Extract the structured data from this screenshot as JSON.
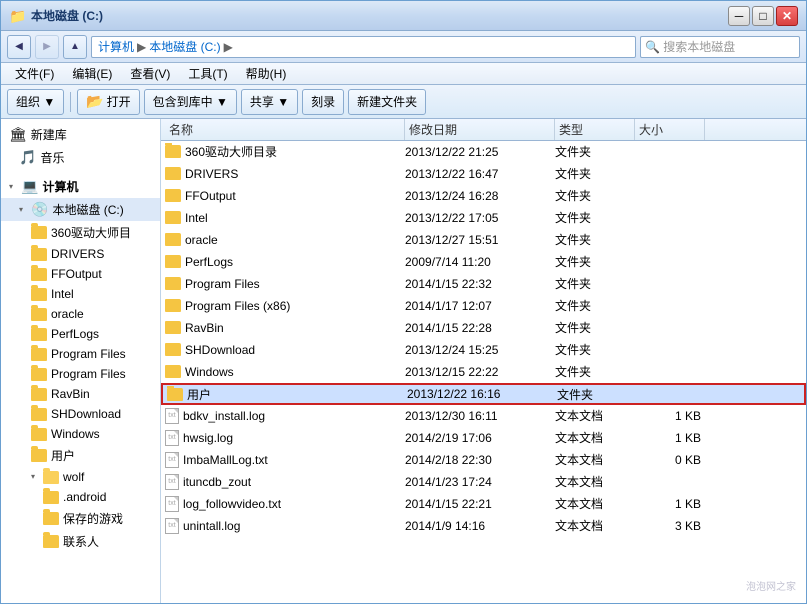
{
  "window": {
    "title": "本地磁盘 (C:)",
    "controls": {
      "minimize": "─",
      "maximize": "□",
      "close": "✕"
    }
  },
  "breadcrumb": {
    "parts": [
      "计算机",
      "本地磁盘 (C:)"
    ]
  },
  "menu": {
    "items": [
      "文件(F)",
      "编辑(E)",
      "查看(V)",
      "工具(T)",
      "帮助(H)"
    ]
  },
  "toolbar": {
    "organize": "组织 ▼",
    "open": "打开",
    "include_library": "包含到库中 ▼",
    "share": "共享 ▼",
    "burn": "刻录",
    "new_folder": "新建文件夹"
  },
  "columns": {
    "name": "名称",
    "date": "修改日期",
    "type": "类型",
    "size": "大小"
  },
  "sidebar": {
    "items": [
      {
        "label": "新建库",
        "indent": 0,
        "icon": "library",
        "type": "library"
      },
      {
        "label": "音乐",
        "indent": 1,
        "icon": "music",
        "type": "music"
      },
      {
        "label": "计算机",
        "indent": 0,
        "icon": "computer",
        "type": "computer",
        "expanded": true
      },
      {
        "label": "本地磁盘 (C:)",
        "indent": 1,
        "icon": "drive",
        "type": "drive",
        "selected": true
      },
      {
        "label": "360驱动大师目",
        "indent": 2,
        "icon": "folder",
        "type": "folder"
      },
      {
        "label": "DRIVERS",
        "indent": 2,
        "icon": "folder",
        "type": "folder"
      },
      {
        "label": "FFOutput",
        "indent": 2,
        "icon": "folder",
        "type": "folder"
      },
      {
        "label": "Intel",
        "indent": 2,
        "icon": "folder",
        "type": "folder"
      },
      {
        "label": "oracle",
        "indent": 2,
        "icon": "folder",
        "type": "folder"
      },
      {
        "label": "PerfLogs",
        "indent": 2,
        "icon": "folder",
        "type": "folder"
      },
      {
        "label": "Program Files",
        "indent": 2,
        "icon": "folder",
        "type": "folder"
      },
      {
        "label": "Program Files",
        "indent": 2,
        "icon": "folder",
        "type": "folder"
      },
      {
        "label": "RavBin",
        "indent": 2,
        "icon": "folder",
        "type": "folder"
      },
      {
        "label": "SHDownload",
        "indent": 2,
        "icon": "folder",
        "type": "folder"
      },
      {
        "label": "Windows",
        "indent": 2,
        "icon": "folder",
        "type": "folder"
      },
      {
        "label": "用户",
        "indent": 2,
        "icon": "folder",
        "type": "folder"
      },
      {
        "label": "wolf",
        "indent": 2,
        "icon": "folder",
        "type": "folder",
        "expanded": true
      },
      {
        "label": ".android",
        "indent": 3,
        "icon": "folder",
        "type": "folder"
      },
      {
        "label": "保存的游戏",
        "indent": 3,
        "icon": "folder",
        "type": "folder"
      },
      {
        "label": "联系人",
        "indent": 3,
        "icon": "folder",
        "type": "folder"
      }
    ]
  },
  "files": [
    {
      "name": "360驱动大师目录",
      "date": "2013/12/22 21:25",
      "type": "文件夹",
      "size": "",
      "kind": "folder"
    },
    {
      "name": "DRIVERS",
      "date": "2013/12/22 16:47",
      "type": "文件夹",
      "size": "",
      "kind": "folder"
    },
    {
      "name": "FFOutput",
      "date": "2013/12/24 16:28",
      "type": "文件夹",
      "size": "",
      "kind": "folder"
    },
    {
      "name": "Intel",
      "date": "2013/12/22 17:05",
      "type": "文件夹",
      "size": "",
      "kind": "folder"
    },
    {
      "name": "oracle",
      "date": "2013/12/27 15:51",
      "type": "文件夹",
      "size": "",
      "kind": "folder"
    },
    {
      "name": "PerfLogs",
      "date": "2009/7/14 11:20",
      "type": "文件夹",
      "size": "",
      "kind": "folder"
    },
    {
      "name": "Program Files",
      "date": "2014/1/15 22:32",
      "type": "文件夹",
      "size": "",
      "kind": "folder"
    },
    {
      "name": "Program Files (x86)",
      "date": "2014/1/17 12:07",
      "type": "文件夹",
      "size": "",
      "kind": "folder"
    },
    {
      "name": "RavBin",
      "date": "2014/1/15 22:28",
      "type": "文件夹",
      "size": "",
      "kind": "folder"
    },
    {
      "name": "SHDownload",
      "date": "2013/12/24 15:25",
      "type": "文件夹",
      "size": "",
      "kind": "folder"
    },
    {
      "name": "Windows",
      "date": "2013/12/15 22:22",
      "type": "文件夹",
      "size": "",
      "kind": "folder"
    },
    {
      "name": "用户",
      "date": "2013/12/22 16:16",
      "type": "文件夹",
      "size": "",
      "kind": "folder",
      "highlighted": true
    },
    {
      "name": "bdkv_install.log",
      "date": "2013/12/30 16:11",
      "type": "文本文档",
      "size": "1 KB",
      "kind": "txt"
    },
    {
      "name": "hwsig.log",
      "date": "2014/2/19 17:06",
      "type": "文本文档",
      "size": "1 KB",
      "kind": "txt"
    },
    {
      "name": "ImbaMallLog.txt",
      "date": "2014/2/18 22:30",
      "type": "文本文档",
      "size": "0 KB",
      "kind": "txt"
    },
    {
      "name": "ituncdb_zout",
      "date": "2014/1/23 17:24",
      "type": "文本文档",
      "size": "",
      "kind": "txt"
    },
    {
      "name": "log_followvideo.txt",
      "date": "2014/1/15 22:21",
      "type": "文本文档",
      "size": "1 KB",
      "kind": "txt"
    },
    {
      "name": "unintall.log",
      "date": "2014/1/9 14:16",
      "type": "文本文档",
      "size": "3 KB",
      "kind": "txt"
    }
  ],
  "watermark": "泡泡网之家"
}
